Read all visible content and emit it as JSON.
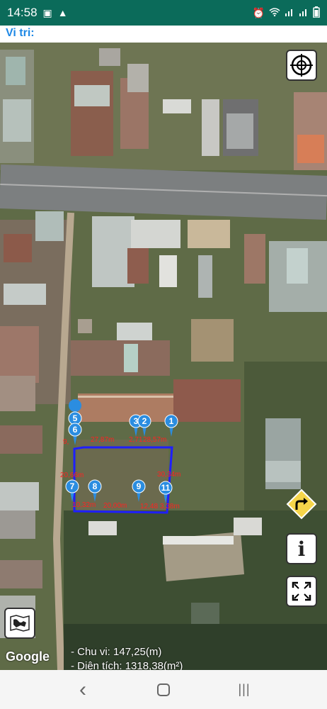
{
  "status_bar": {
    "time": "14:58",
    "left_icons": [
      "photo-icon",
      "alert-icon"
    ],
    "right_icons": [
      "alarm-icon",
      "wifi-icon",
      "signal-icon",
      "signal-icon",
      "battery-icon"
    ]
  },
  "location": {
    "label": "Vi tri:"
  },
  "map": {
    "boundary_color": "#1f1fff",
    "pin_color": "#2b8de0",
    "pins": [
      "1",
      "2",
      "3",
      "5",
      "6",
      "7",
      "8",
      "9",
      "11"
    ],
    "measurements": [
      "27,87m",
      "2,71",
      "28,57m",
      "20,66m",
      "30,34m",
      "10,32m",
      "20,00m",
      "12,48",
      "3,38m",
      "9,"
    ],
    "buttons": {
      "target": "crosshair-icon",
      "turn": "turn-right-icon",
      "info": "i",
      "fullscreen": "fullscreen-icon",
      "layers": "map-layers-icon"
    },
    "attribution": "Google"
  },
  "summary": {
    "perimeter": "- Chu vi: 147,25(m)",
    "area": "- Diện tích: 1318,38(m²)"
  },
  "nav": {
    "back": "‹",
    "recents": "|||"
  }
}
